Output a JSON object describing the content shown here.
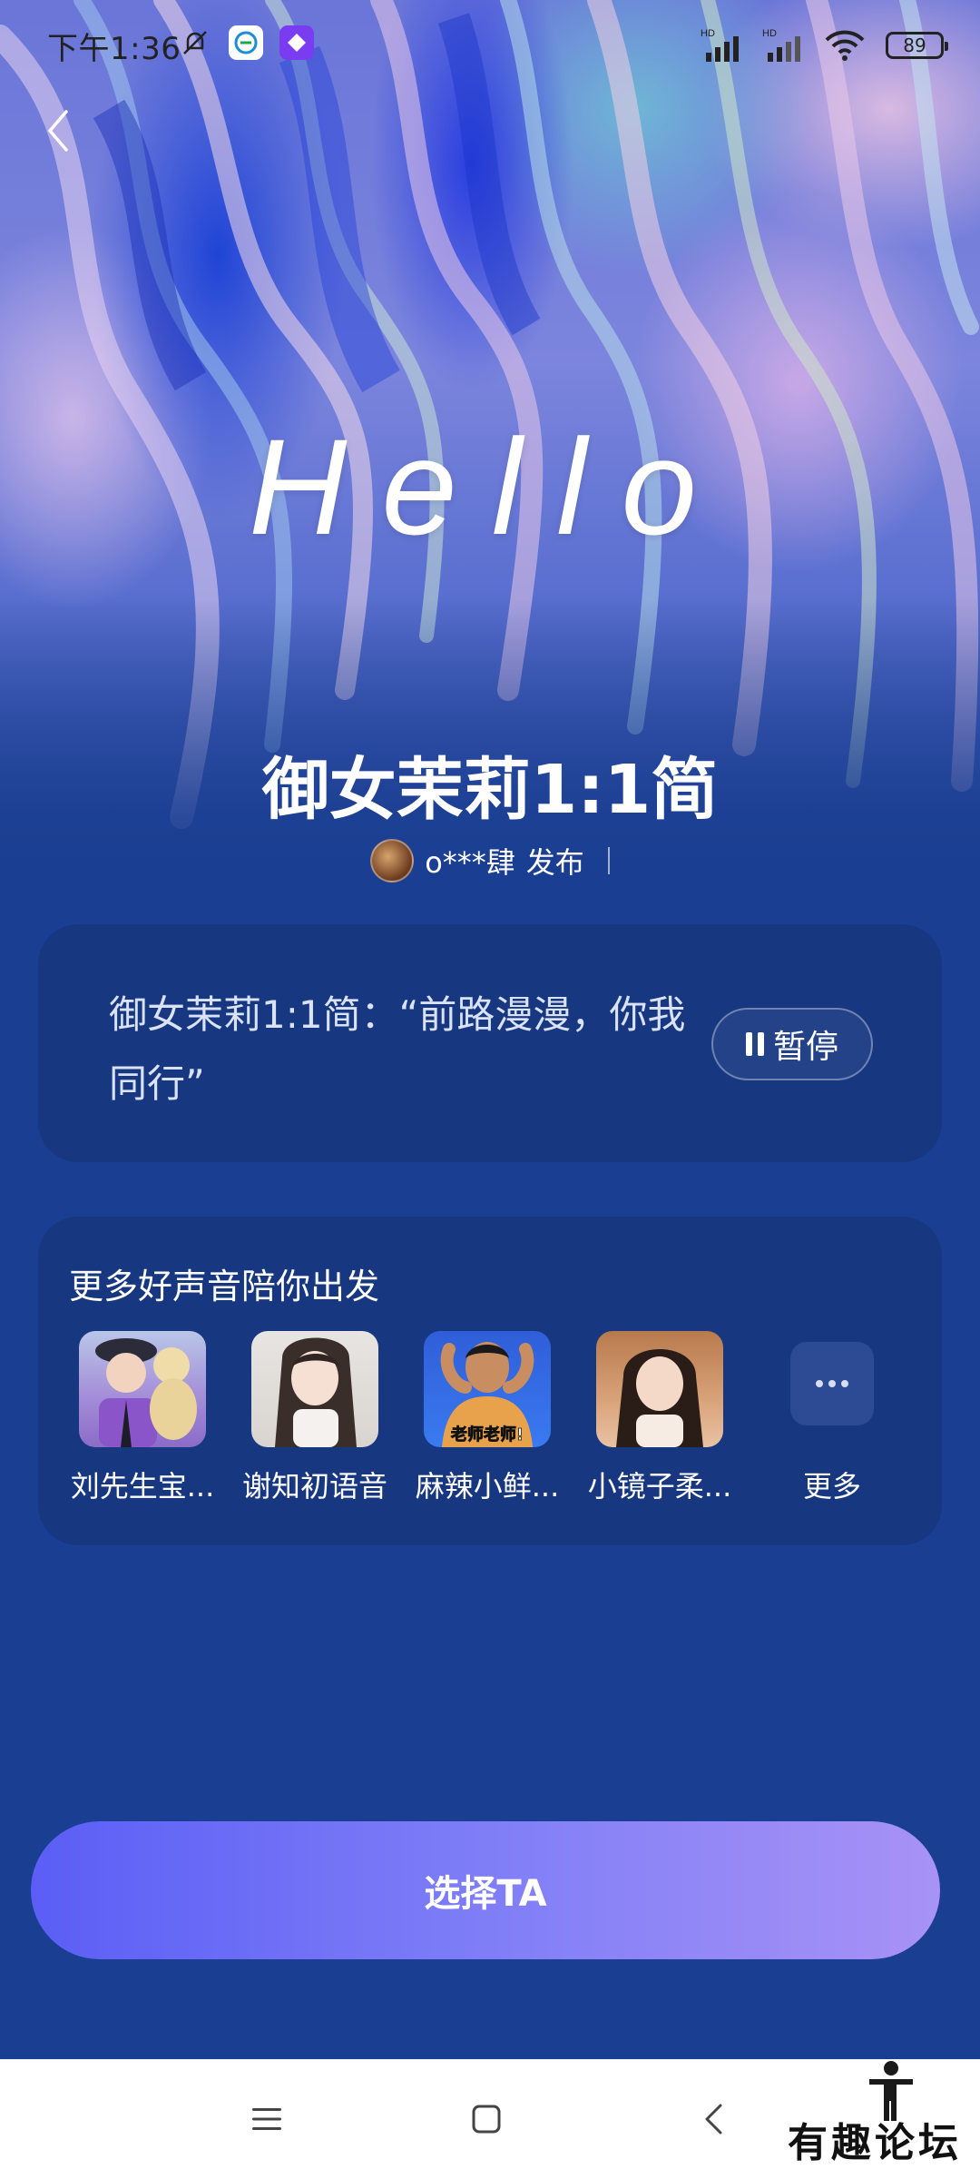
{
  "status_bar": {
    "time": "下午1:36",
    "battery": "89",
    "signal_label_1": "HD",
    "signal_label_2": "HD"
  },
  "hero": {
    "hello_text": "Hello",
    "voice_title": "御女茉莉1:1简",
    "publisher_name": "o***肆",
    "publisher_action": "发布"
  },
  "quote_card": {
    "quote_text": "御女茉莉1:1简：“前路漫漫，你我同行”",
    "pause_label": "暂停"
  },
  "more_voices": {
    "title": "更多好声音陪你出发",
    "items": [
      {
        "name": "刘先生宝..."
      },
      {
        "name": "谢知初语音"
      },
      {
        "name": "麻辣小鲜...",
        "badge": "老师老师!"
      },
      {
        "name": "小镜子柔..."
      },
      {
        "name": "更多"
      }
    ]
  },
  "cta": {
    "select_label": "选择TA"
  },
  "watermark": {
    "text": "有趣论坛"
  },
  "colors": {
    "background": "#1a3e91",
    "card": "#173781",
    "cta_start": "#5b5ef5",
    "cta_end": "#a892f6"
  }
}
